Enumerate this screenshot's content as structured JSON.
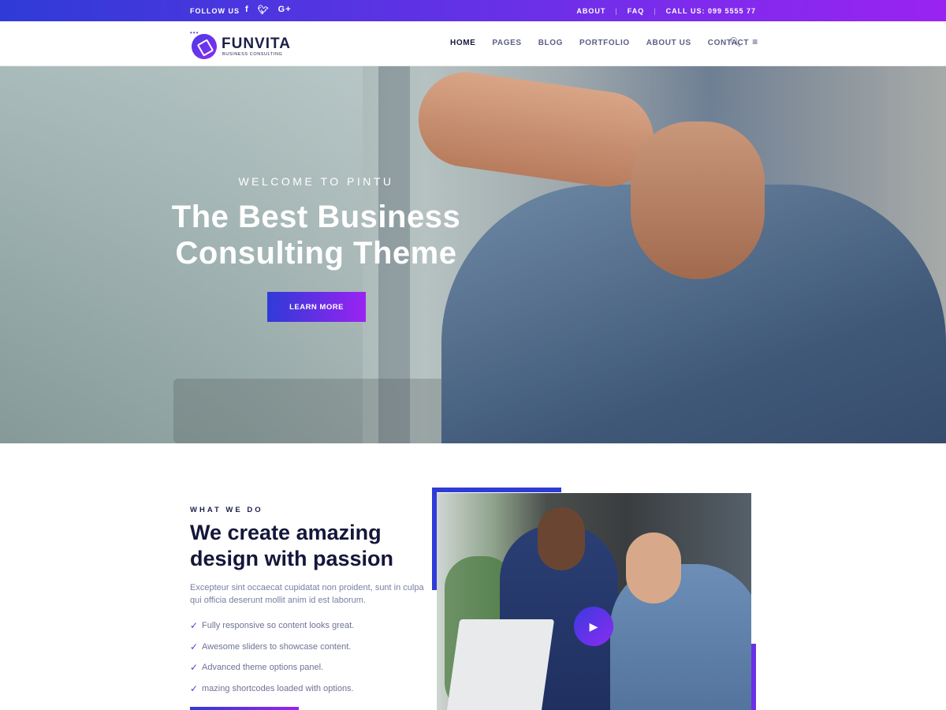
{
  "topbar": {
    "follow_label": "FOLLOW US",
    "social": [
      "f",
      "t",
      "G+"
    ],
    "links": [
      "ABOUT",
      "FAQ"
    ],
    "separator": "|",
    "call": "CALL US: 099 5555 77"
  },
  "header": {
    "logo_name": "FUNVITA",
    "logo_tagline": "BUSINESS CONSULTING",
    "nav": [
      "HOME",
      "PAGES",
      "BLOG",
      "PORTFOLIO",
      "ABOUT US",
      "CONTACT"
    ],
    "active_nav": "HOME",
    "icons": [
      "search-icon",
      "menu-icon"
    ]
  },
  "hero": {
    "subtitle": "WELCOME TO PINTU",
    "title_part1": "The Best ",
    "title_part2": "Business",
    "title_part3": "Consulting",
    "title_part4": " Theme",
    "button": "LEARN MORE"
  },
  "what_we_do": {
    "eyebrow": "WHAT WE DO",
    "title": "We create amazing design with passion",
    "description": "Excepteur sint occaecat cupidatat non proident, sunt in culpa qui officia deserunt mollit anim id est laborum.",
    "features": [
      "Fully responsive so content looks great.",
      "Awesome sliders to showcase content.",
      "Advanced theme options panel.",
      "mazing shortcodes loaded with options."
    ]
  },
  "colors": {
    "accent_start": "#2f3bd6",
    "accent_end": "#9a23f2",
    "heading": "#14163a"
  }
}
